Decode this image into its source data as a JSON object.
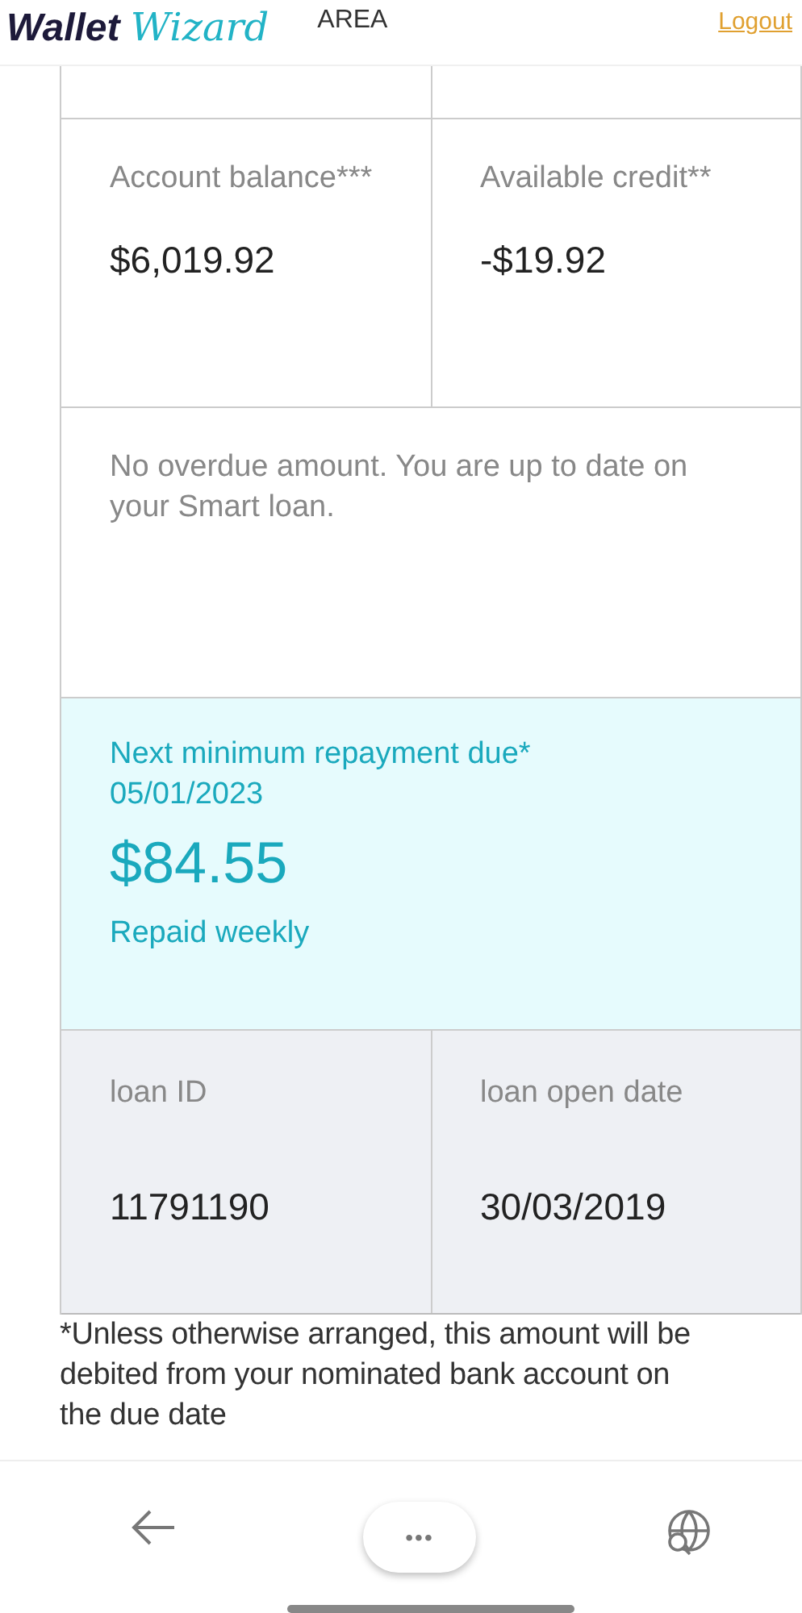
{
  "header": {
    "logo": {
      "word_1": "Wallet",
      "word_2": "Wizard"
    },
    "area_label": "AREA",
    "logout": "Logout"
  },
  "summary": [
    {
      "label": "Account balance***",
      "value": "$6,019.92"
    },
    {
      "label": "Available credit**",
      "value": "-$19.92"
    }
  ],
  "overdue_note": "No overdue amount. You are up to date on your Smart loan.",
  "repayment": {
    "title": "Next minimum repayment due*",
    "date": "05/01/2023",
    "amount": "$84.55",
    "frequency": "Repaid weekly"
  },
  "loan": [
    {
      "label": "loan ID",
      "value": "11791190"
    },
    {
      "label": "loan open date",
      "value": "30/03/2019"
    }
  ],
  "footnote": "*Unless otherwise arranged, this amount will be debited from your nominated bank account on the due date",
  "browser_bar": {
    "menu_glyph": "•••"
  }
}
